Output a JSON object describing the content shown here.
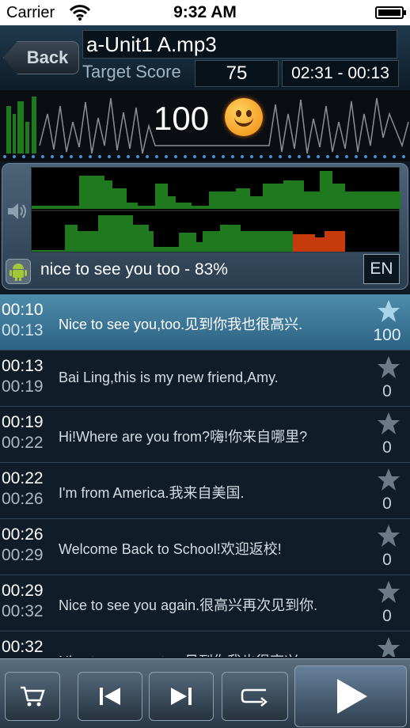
{
  "status": {
    "carrier": "Carrier",
    "time": "9:32 AM"
  },
  "header": {
    "back_label": "Back",
    "file_name": "a-Unit1 A.mp3",
    "target_label": "Target Score",
    "target_score": "75",
    "time_range": "02:31 - 00:13"
  },
  "waveform": {
    "score": "100"
  },
  "pitch": {
    "recognized_text": "nice to see you too - 83%",
    "language": "EN"
  },
  "rows": [
    {
      "start": "00:10",
      "end": "00:13",
      "text": "Nice to see you,too.见到你我也很高兴.",
      "score": "100",
      "selected": true
    },
    {
      "start": "00:13",
      "end": "00:19",
      "text": "Bai Ling,this is my new friend,Amy.",
      "score": "0"
    },
    {
      "start": "00:19",
      "end": "00:22",
      "text": "Hi!Where are you from?嗨!你来自哪里?",
      "score": "0"
    },
    {
      "start": "00:22",
      "end": "00:26",
      "text": "I'm from America.我来自美国.",
      "score": "0"
    },
    {
      "start": "00:26",
      "end": "00:29",
      "text": "Welcome Back to School!欢迎返校!",
      "score": "0"
    },
    {
      "start": "00:29",
      "end": "00:32",
      "text": "Nice to see you again.很高兴再次见到你.",
      "score": "0"
    },
    {
      "start": "00:32",
      "end": "",
      "text": "Nice to see you too.见到你我也很高兴.",
      "score": ""
    }
  ],
  "toolbar": {
    "cart_icon": "cart-icon",
    "previous_icon": "skip-previous-icon",
    "next_icon": "skip-next-icon",
    "repeat_icon": "repeat-icon",
    "play_icon": "play-icon"
  },
  "colors": {
    "pitch_green": "#1f8a1f",
    "pitch_red": "#cc3a0e",
    "selected_row": "#3d7798",
    "star_selected": "#a7d4e9",
    "star_default": "#6b7a86"
  }
}
